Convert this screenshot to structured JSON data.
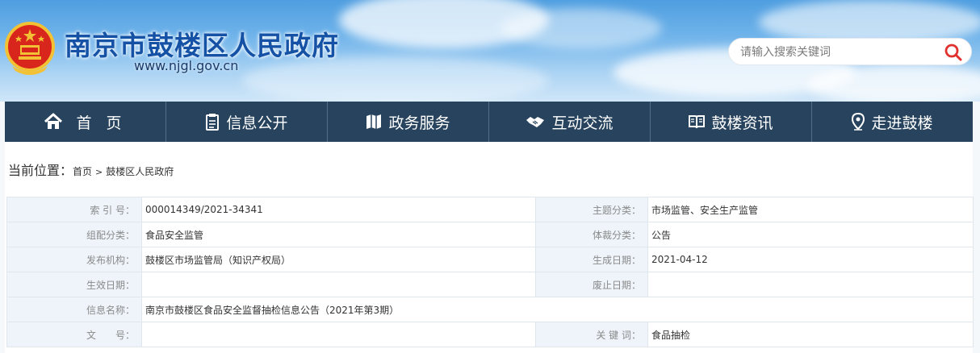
{
  "header": {
    "site_title": "南京市鼓楼区人民政府",
    "site_url": "www.njgl.gov.cn",
    "search_placeholder": "请输入搜索关键词"
  },
  "nav": {
    "items": [
      {
        "label": "首 页",
        "icon": "home-icon"
      },
      {
        "label": "信息公开",
        "icon": "clipboard-icon"
      },
      {
        "label": "政务服务",
        "icon": "map-icon"
      },
      {
        "label": "互动交流",
        "icon": "handshake-icon"
      },
      {
        "label": "鼓楼资讯",
        "icon": "book-icon"
      },
      {
        "label": "走进鼓楼",
        "icon": "location-pin-icon"
      }
    ]
  },
  "breadcrumb": {
    "prefix": "当前位置：",
    "home": "首页",
    "separator": ">",
    "current": "鼓楼区人民政府"
  },
  "meta": {
    "index_label": "索 引 号：",
    "index_value": "000014349/2021-34341",
    "topic_label": "主题分类：",
    "topic_value": "市场监管、安全生产监管",
    "category_label": "组配分类：",
    "category_value": "食品安全监管",
    "genre_label": "体裁分类：",
    "genre_value": "公告",
    "publisher_label": "发布机构：",
    "publisher_value": "鼓楼区市场监管局（知识产权局）",
    "created_label": "生成日期：",
    "created_value": "2021-04-12",
    "effective_label": "生效日期：",
    "effective_value": "",
    "repeal_label": "废止日期：",
    "repeal_value": "",
    "name_label": "信息名称：",
    "name_value": "南京市鼓楼区食品安全监督抽检信息公告（2021年第3期）",
    "docno_label": "文　　号：",
    "docno_value": "",
    "keyword_label": "关 键 词：",
    "keyword_value": "食品抽检"
  },
  "colors": {
    "nav_bg": "#27435d",
    "title_blue": "#1552a6",
    "label_bg": "#eef4fa",
    "search_icon": "#e0312f"
  }
}
